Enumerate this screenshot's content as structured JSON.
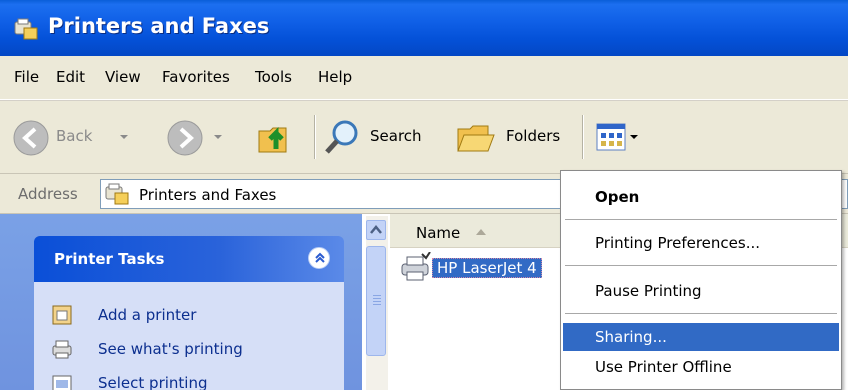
{
  "window": {
    "title": "Printers and Faxes"
  },
  "menu": {
    "items": [
      "File",
      "Edit",
      "View",
      "Favorites",
      "Tools",
      "Help"
    ]
  },
  "toolbar": {
    "back_label": "Back",
    "search_label": "Search",
    "folders_label": "Folders"
  },
  "address": {
    "label": "Address",
    "value": "Printers and Faxes"
  },
  "task_pane": {
    "header": "Printer Tasks",
    "links": [
      "Add a printer",
      "See what's printing",
      "Select printing"
    ]
  },
  "file_list": {
    "column_name": "Name",
    "items": [
      {
        "name": "HP LaserJet 4",
        "selected": true
      }
    ]
  },
  "context_menu": {
    "items": [
      {
        "label": "Open",
        "default": true
      },
      {
        "label": "Printing Preferences..."
      },
      {
        "label": "Pause Printing"
      },
      {
        "label": "Sharing...",
        "highlighted": true
      },
      {
        "label": "Use Printer Offline"
      }
    ]
  },
  "colors": {
    "titlebar": "#0451d8",
    "chrome": "#ece9d8",
    "selection": "#316ac5",
    "task_pane": "#6f93df"
  }
}
